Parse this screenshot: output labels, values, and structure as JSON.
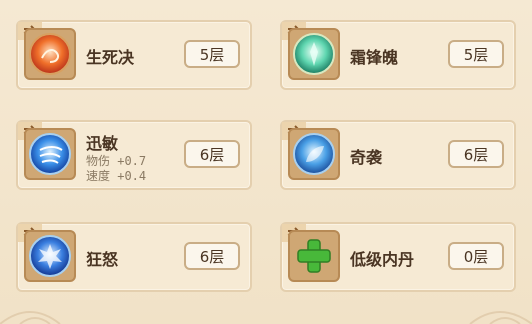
{
  "skills": [
    {
      "name": "生死决",
      "level": "5层",
      "icon": "orb-red-flame-icon"
    },
    {
      "name": "霜锋魄",
      "level": "5层",
      "icon": "orb-green-frost-icon"
    },
    {
      "name": "迅敏",
      "level": "6层",
      "icon": "orb-blue-wind-icon",
      "stats": [
        "物伤 +0.7",
        "速度 +0.4"
      ]
    },
    {
      "name": "奇袭",
      "level": "6层",
      "icon": "orb-blue-leaf-icon"
    },
    {
      "name": "狂怒",
      "level": "6层",
      "icon": "orb-blue-burst-icon"
    },
    {
      "name": "低级内丹",
      "level": "0层",
      "icon": "green-plus-icon"
    }
  ],
  "colors": {
    "background": "#f3e6cf",
    "card_border": "#e4cfae",
    "text": "#4a3523",
    "stat_text": "#8a7a63"
  }
}
